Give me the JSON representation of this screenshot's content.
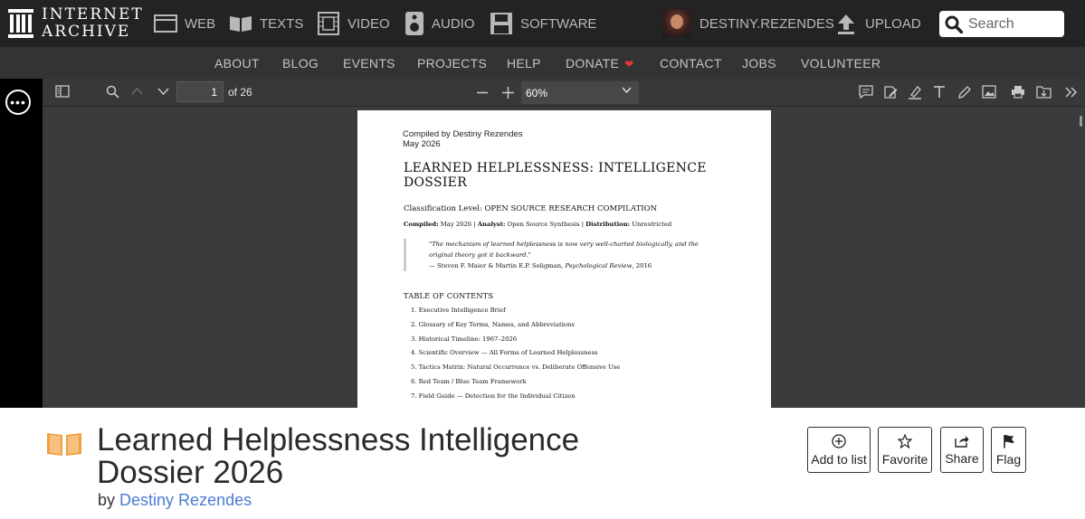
{
  "topnav": {
    "logo_line1": "INTERNET",
    "logo_line2": "ARCHIVE",
    "items": [
      {
        "label": "WEB",
        "icon": "web-icon"
      },
      {
        "label": "TEXTS",
        "icon": "texts-icon"
      },
      {
        "label": "VIDEO",
        "icon": "video-icon"
      },
      {
        "label": "AUDIO",
        "icon": "audio-icon"
      },
      {
        "label": "SOFTWARE",
        "icon": "software-icon"
      }
    ],
    "username": "DESTINY.REZENDES",
    "upload_label": "UPLOAD",
    "search_placeholder": "Search"
  },
  "subnav": {
    "items": [
      "ABOUT",
      "BLOG",
      "EVENTS",
      "PROJECTS",
      "HELP",
      "DONATE",
      "CONTACT",
      "JOBS",
      "VOLUNTEER"
    ]
  },
  "reader": {
    "current_page": "1",
    "page_count_label": "of 26",
    "zoom_value": "60%",
    "document": {
      "compiled_by": "Compiled by Destiny Rezendes",
      "date": "May 2026",
      "title": "LEARNED HELPLESSNESS: INTELLIGENCE DOSSIER",
      "classification": "Classification Level: OPEN SOURCE RESEARCH COMPILATION",
      "compiled_line": {
        "compiled_label": "Compiled:",
        "compiled_value": " May 2026 | ",
        "analyst_label": "Analyst:",
        "analyst_value": " Open Source Synthesis | ",
        "distribution_label": "Distribution:",
        "distribution_value": " Unrestricted"
      },
      "quote_text": "\"The mechanism of learned helplessness is now very well-charted biologically, and the original theory got it backward.\"",
      "quote_attribution": "— Steven F. Maier & Martin E.P. Seligman, ",
      "quote_journal": "Psychological Review",
      "quote_year": ", 2016",
      "toc_heading": "TABLE OF CONTENTS",
      "toc": [
        "1. Executive Intelligence Brief",
        "2. Glossary of Key Terms, Names, and Abbreviations",
        "3. Historical Timeline: 1967–2026",
        "4. Scientific Overview — All Forms of Learned Helplessness",
        "5. Tactics Matrix: Natural Occurrence vs. Deliberate Offensive Use",
        "6. Red Team / Blue Team Framework",
        "7. Field Guide — Detection for the Individual Citizen"
      ]
    }
  },
  "item": {
    "title": "Learned Helplessness Intelligence Dossier 2026",
    "by_label": "by",
    "author": "Destiny Rezendes",
    "actions": [
      {
        "label": "Add to list",
        "icon": "add-circle-icon"
      },
      {
        "label": "Favorite",
        "icon": "star-icon"
      },
      {
        "label": "Share",
        "icon": "share-icon"
      },
      {
        "label": "Flag",
        "icon": "flag-icon"
      }
    ]
  },
  "colors": {
    "nav_bg": "#232323",
    "subnav_bg": "#333333",
    "reader_bg": "#3b3b3b",
    "author_link": "#4a7bd3",
    "donate_heart": "#e03a3a",
    "book_icon": "#f2a03d"
  }
}
